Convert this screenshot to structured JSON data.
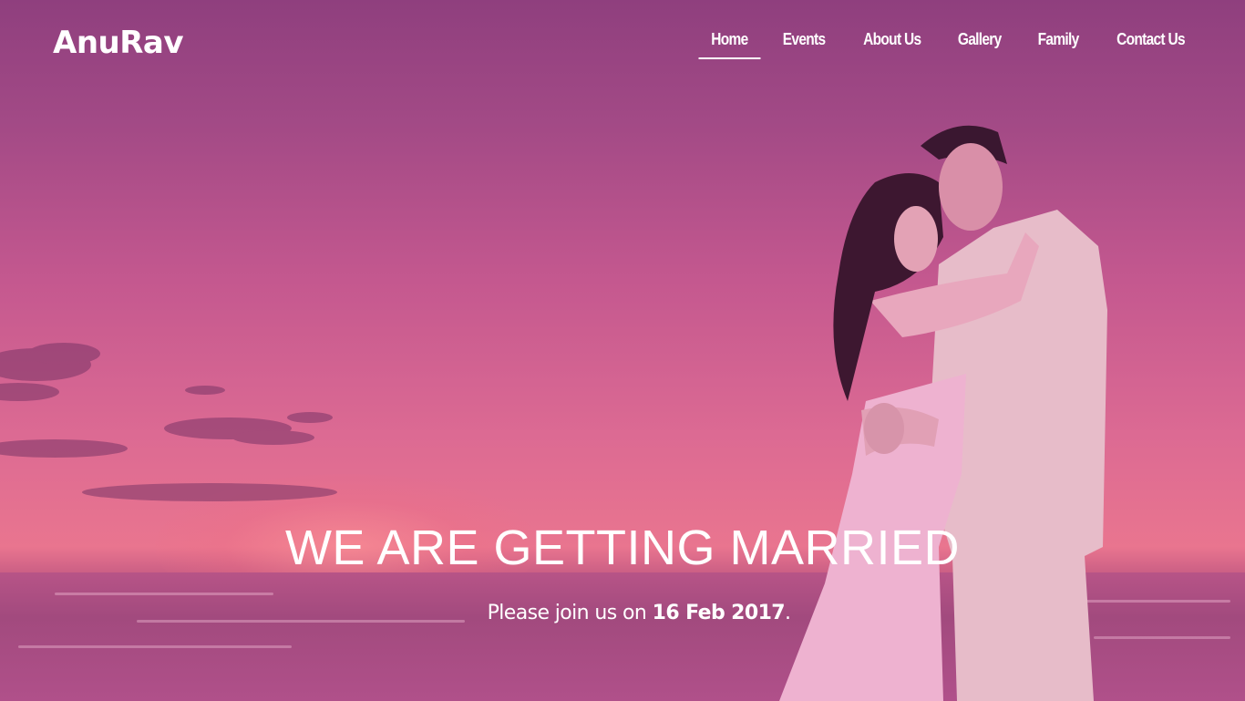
{
  "brand": {
    "name": "AnuRav"
  },
  "nav": {
    "items": [
      {
        "label": "Home",
        "active": true
      },
      {
        "label": "Events",
        "active": false
      },
      {
        "label": "About Us",
        "active": false
      },
      {
        "label": "Gallery",
        "active": false
      },
      {
        "label": "Family",
        "active": false
      },
      {
        "label": "Contact Us",
        "active": false
      }
    ]
  },
  "hero": {
    "title": "WE ARE GETTING MARRIED",
    "subtitle_prefix": "Please join us on ",
    "date": "16 Feb 2017",
    "subtitle_suffix": "."
  },
  "colors": {
    "overlay": "#c4588f",
    "text": "#ffffff"
  }
}
